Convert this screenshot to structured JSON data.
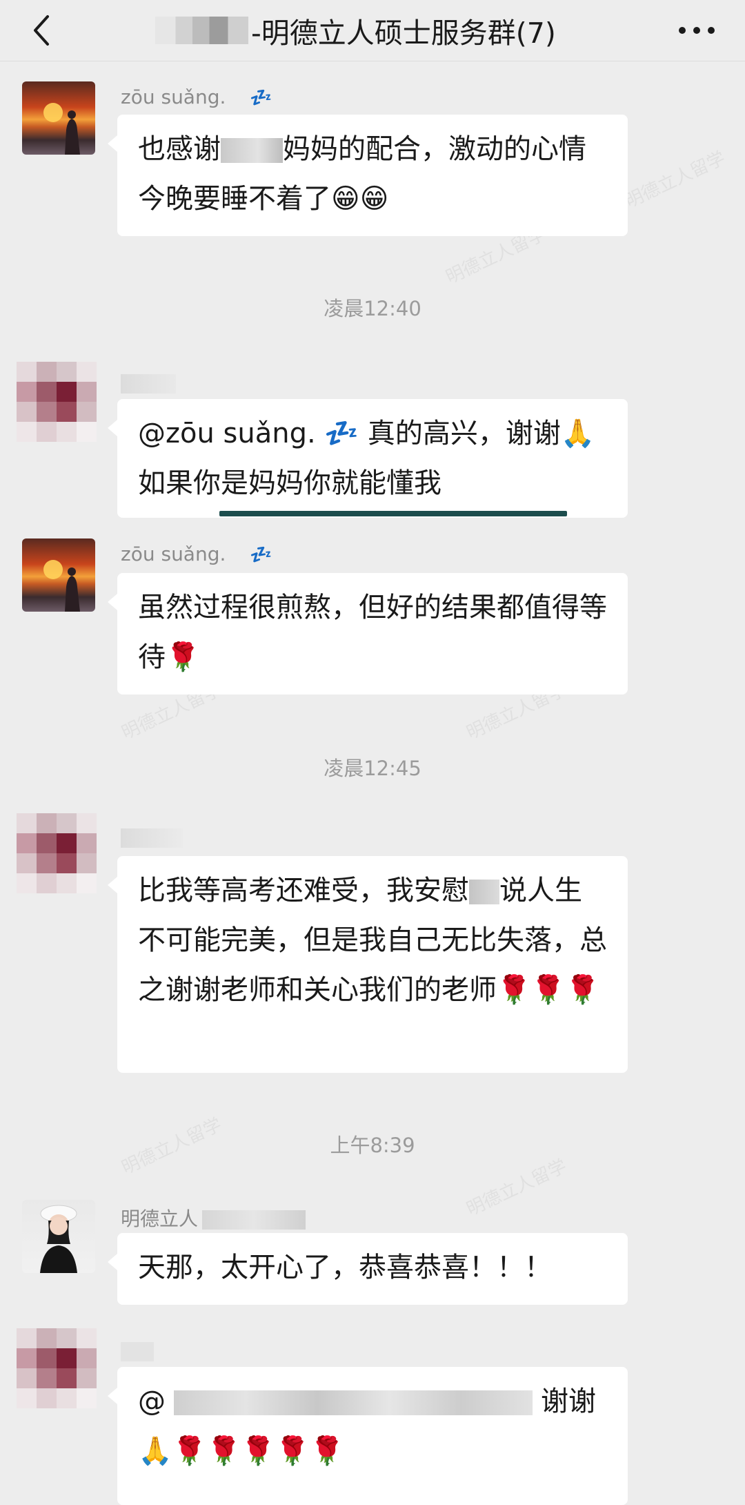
{
  "header": {
    "title": "-明德立人硕士服务群(7)"
  },
  "messages": [
    {
      "sender": "zōu suǎng.",
      "text_before": "也感谢",
      "text_after": "妈妈的配合，激动的心情今晚要睡不着了😁😁"
    },
    {
      "timestamp": "凌晨12:40"
    },
    {
      "sender": "",
      "text": "@zōu suǎng.  💤 真的高兴，谢谢🙏如果你是妈妈你就能懂我"
    },
    {
      "sender": "zōu suǎng.",
      "text": "虽然过程很煎熬，但好的结果都值得等待🌹"
    },
    {
      "timestamp": "凌晨12:45"
    },
    {
      "sender": "",
      "text_before": "比我等高考还难受，我安慰",
      "text_after": "说人生不可能完美，但是我自己无比失落，总之谢谢老师和关心我们的老师🌹🌹🌹"
    },
    {
      "timestamp": "上午8:39"
    },
    {
      "sender": "明德立人",
      "text": "天那，太开心了，恭喜恭喜！！！"
    },
    {
      "sender": "",
      "text_before": "@",
      "text_after": "谢谢",
      "text_line2": "🙏🌹🌹🌹🌹🌹"
    }
  ],
  "zzz": "💤",
  "watermark": "明德立人留学",
  "colors": {
    "background": "#ededed",
    "bubble": "#ffffff",
    "underline": "#1c4d4d"
  }
}
